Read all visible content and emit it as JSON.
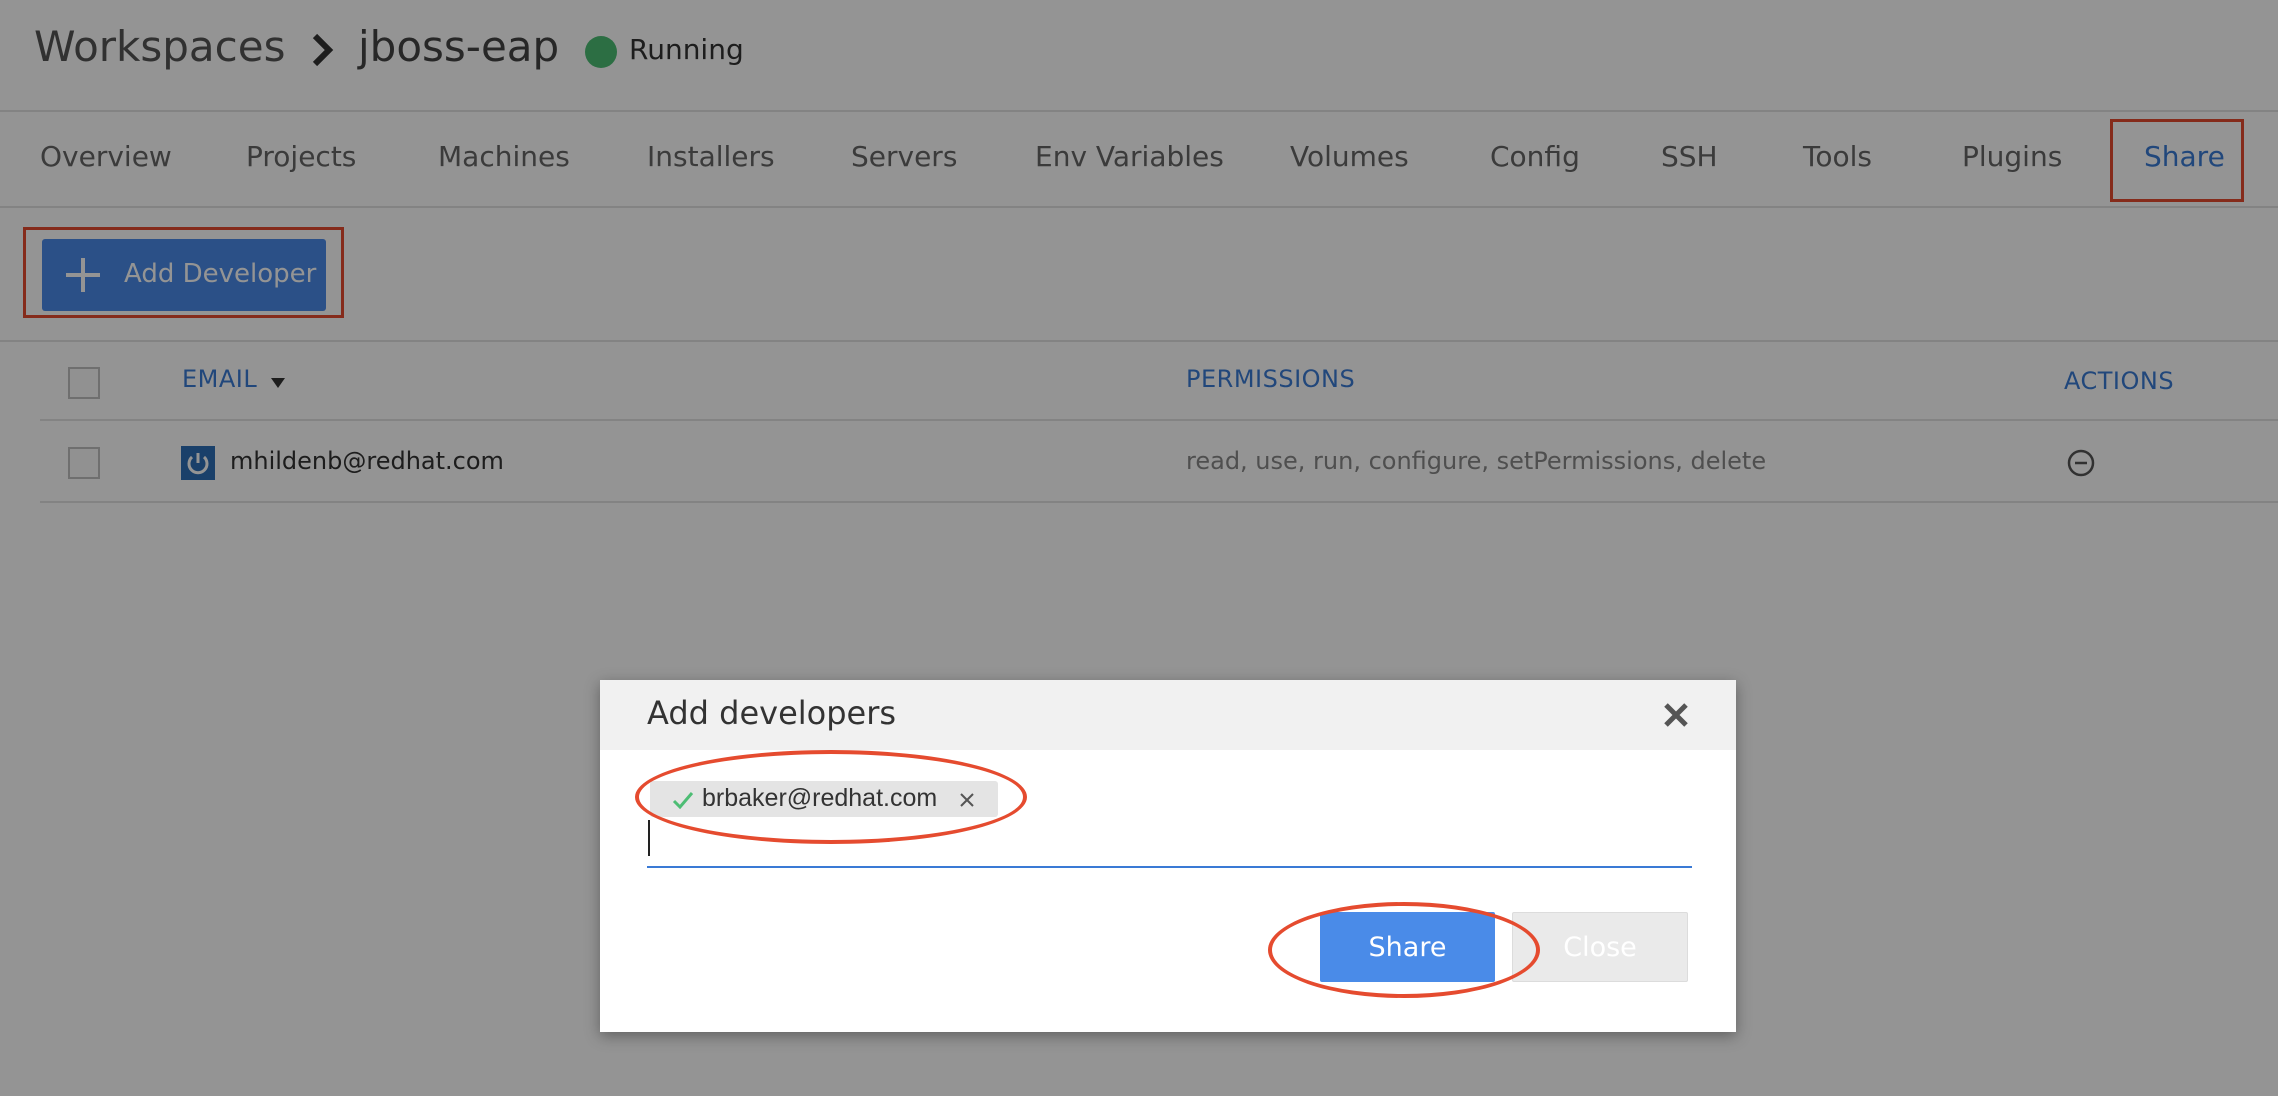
{
  "header": {
    "breadcrumb_root": "Workspaces",
    "breadcrumb_current": "jboss-eap",
    "status_label": "Running",
    "status_color": "#4dbd74",
    "separator_icon": "chevron-right-icon"
  },
  "tabs": [
    {
      "label": "Overview",
      "active": false
    },
    {
      "label": "Projects",
      "active": false
    },
    {
      "label": "Machines",
      "active": false
    },
    {
      "label": "Installers",
      "active": false
    },
    {
      "label": "Servers",
      "active": false
    },
    {
      "label": "Env Variables",
      "active": false
    },
    {
      "label": "Volumes",
      "active": false
    },
    {
      "label": "Config",
      "active": false
    },
    {
      "label": "SSH",
      "active": false
    },
    {
      "label": "Tools",
      "active": false
    },
    {
      "label": "Plugins",
      "active": false
    },
    {
      "label": "Share",
      "active": true
    }
  ],
  "toolbar": {
    "add_developer_label": "Add Developer",
    "add_icon": "plus-icon"
  },
  "table": {
    "columns": [
      "EMAIL",
      "PERMISSIONS",
      "ACTIONS"
    ],
    "rows": [
      {
        "email": "mhildenb@redhat.com",
        "permissions": "read, use, run, configure, setPermissions, delete",
        "avatar_icon": "power-icon",
        "action_icon": "remove-circle-icon"
      }
    ]
  },
  "modal": {
    "title": "Add developers",
    "close_icon": "close-icon",
    "chips": [
      {
        "email": "brbaker@redhat.com",
        "valid": true
      }
    ],
    "input_value": "",
    "share_label": "Share",
    "close_label": "Close"
  },
  "colors": {
    "accent": "#4a8be8",
    "link": "#3a7ad5",
    "annotation": "#e54b2f"
  }
}
